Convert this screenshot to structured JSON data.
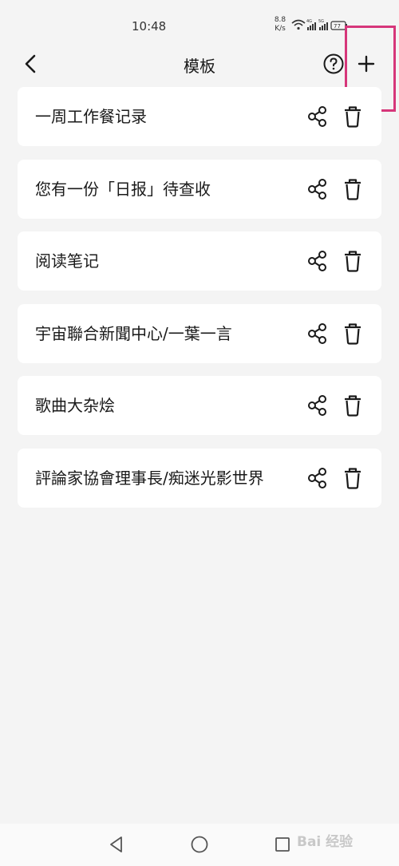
{
  "status_bar": {
    "time": "10:48",
    "speed_value": "8.8",
    "speed_unit": "K/s",
    "network_labels": [
      "4G",
      "5G"
    ],
    "battery_level": "77"
  },
  "header": {
    "title": "模板",
    "back_icon": "chevron-left-icon",
    "help_icon": "question-circle-icon",
    "add_icon": "plus-icon"
  },
  "highlight_color": "#d6367a",
  "templates": [
    {
      "title": "一周工作餐记录"
    },
    {
      "title": "您有一份「日报」待查收"
    },
    {
      "title": "阅读笔记"
    },
    {
      "title": "宇宙聯合新聞中心/一葉一言"
    },
    {
      "title": "歌曲大杂烩"
    },
    {
      "title": "評論家協會理事長/痴迷光影世界"
    }
  ],
  "card_icons": {
    "share": "share-icon",
    "delete": "trash-icon"
  },
  "nav": {
    "back_icon": "triangle-back-icon",
    "home_icon": "circle-home-icon",
    "recent_icon": "square-recent-icon"
  },
  "watermark": "Bai 经验"
}
